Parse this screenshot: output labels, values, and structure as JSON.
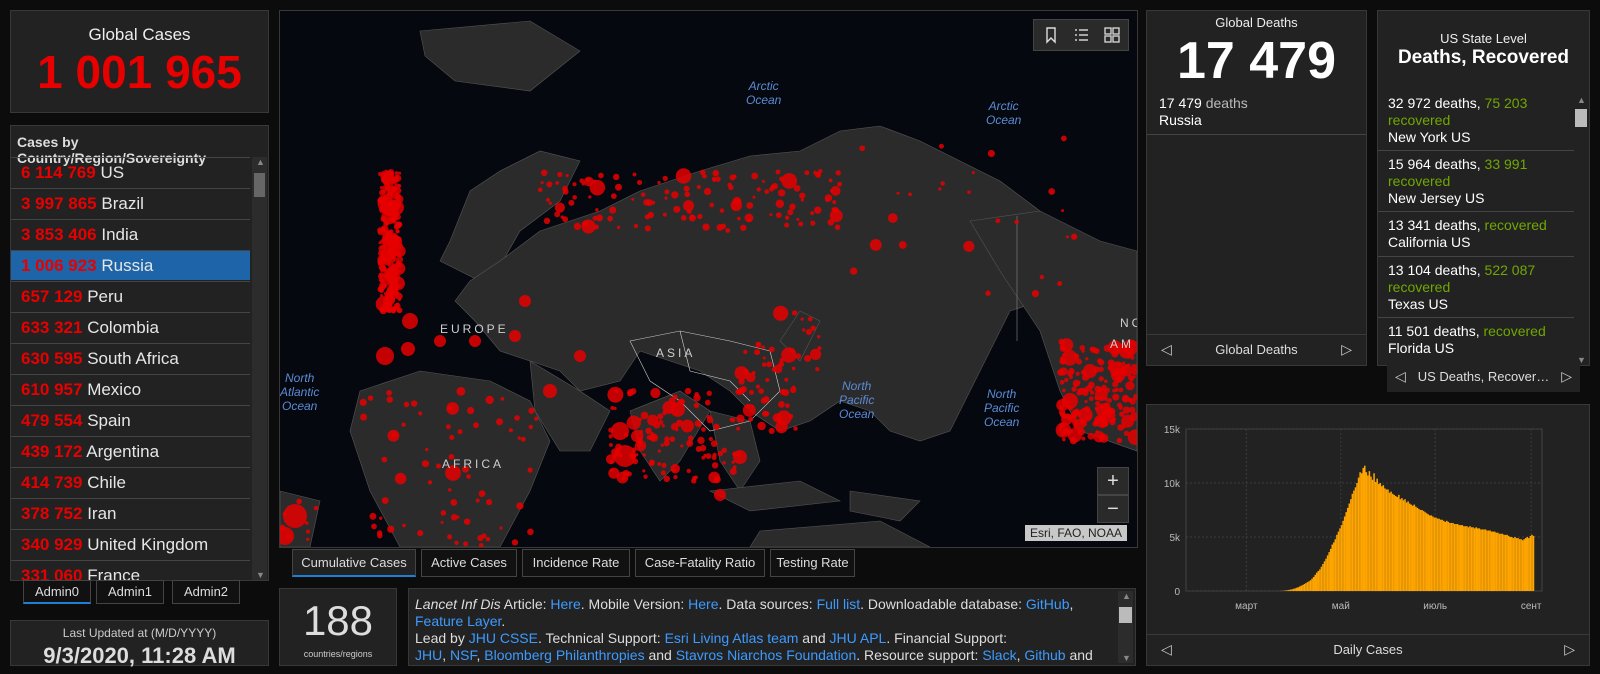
{
  "global_cases": {
    "title": "Global Cases",
    "value": "1 001 965"
  },
  "country_list": {
    "header": "Cases by Country/Region/Sovereignty",
    "rows": [
      {
        "num": "6 114 769",
        "name": "US"
      },
      {
        "num": "3 997 865",
        "name": "Brazil"
      },
      {
        "num": "3 853 406",
        "name": "India"
      },
      {
        "num": "1 006 923",
        "name": "Russia"
      },
      {
        "num": "657 129",
        "name": "Peru"
      },
      {
        "num": "633 321",
        "name": "Colombia"
      },
      {
        "num": "630 595",
        "name": "South Africa"
      },
      {
        "num": "610 957",
        "name": "Mexico"
      },
      {
        "num": "479 554",
        "name": "Spain"
      },
      {
        "num": "439 172",
        "name": "Argentina"
      },
      {
        "num": "414 739",
        "name": "Chile"
      },
      {
        "num": "378 752",
        "name": "Iran"
      },
      {
        "num": "340 929",
        "name": "United Kingdom"
      },
      {
        "num": "331 060",
        "name": "France"
      }
    ]
  },
  "admin_tabs": [
    "Admin0",
    "Admin1",
    "Admin2"
  ],
  "last_updated": {
    "label": "Last Updated at (M/D/YYYY)",
    "value": "9/3/2020, 11:28 AM"
  },
  "map": {
    "oceans": [
      {
        "l1": "Arctic",
        "l2": "Ocean"
      },
      {
        "l1": "Arctic",
        "l2": "Ocean"
      },
      {
        "l1": "North",
        "l2": "Atlantic",
        "l3": "Ocean"
      },
      {
        "l1": "North",
        "l2": "Pacific",
        "l3": "Ocean"
      },
      {
        "l1": "North",
        "l2": "Pacific",
        "l3": "Ocean"
      }
    ],
    "continents": [
      "EUROPE",
      "ASIA",
      "AFRICA",
      "NO",
      "AM"
    ],
    "attribution": "Esri, FAO, NOAA",
    "zoom_in": "+",
    "zoom_out": "−"
  },
  "map_tabs": [
    "Cumulative Cases",
    "Active Cases",
    "Incidence Rate",
    "Case-Fatality Ratio",
    "Testing Rate"
  ],
  "countries_count": {
    "value": "188",
    "label": "countries/regions"
  },
  "info": {
    "s1": "Lancet Inf Dis",
    "s2": " Article: ",
    "a1": "Here",
    "s3": ". Mobile Version: ",
    "a2": "Here",
    "s4": ". Data sources: ",
    "a3": "Full list",
    "s5": ". Downloadable database: ",
    "a4": "GitHub",
    "s6": ",",
    "a5": "Feature Layer",
    "s7": ".",
    "s8": "Lead by ",
    "a6": "JHU CSSE",
    "s9": ". Technical Support: ",
    "a7": "Esri Living Atlas team",
    "s10": " and ",
    "a8": "JHU APL",
    "s11": ". Financial Support:",
    "a9": "JHU",
    "s12": ", ",
    "a10": "NSF",
    "s13": ", ",
    "a11": "Bloomberg Philanthropies",
    "s14": " and ",
    "a12": "Stavros Niarchos Foundation",
    "s15": ". Resource support: ",
    "a13": "Slack",
    "s16": ", ",
    "a14": "Github",
    "s17": " and"
  },
  "global_deaths": {
    "title": "Global Deaths",
    "value": "17 479",
    "item_num": "17 479",
    "item_unit": " deaths",
    "item_place": "Russia",
    "pager_label": "Global Deaths"
  },
  "us_state": {
    "title1": "US State Level",
    "title2": "Deaths, Recovered",
    "rows": [
      {
        "deaths": "32 972 deaths, ",
        "recovered_num": "75 203",
        "recovered": "recovered",
        "place": "New York US"
      },
      {
        "deaths": "15 964 deaths, ",
        "recovered_num": "33 991",
        "recovered": "recovered",
        "place": "New Jersey US"
      },
      {
        "deaths": "13 341 deaths, ",
        "recovered_num": "",
        "recovered": "recovered",
        "place": "California US"
      },
      {
        "deaths": "13 104 deaths, ",
        "recovered_num": "522 087",
        "recovered": "recovered",
        "place": "Texas US"
      },
      {
        "deaths": "11 501 deaths, ",
        "recovered_num": "",
        "recovered": "recovered",
        "place": "Florida US"
      }
    ],
    "pager_label": "US Deaths, Recover…"
  },
  "daily_chart_pager": "Daily Cases",
  "colors": {
    "case_red": "#e60000",
    "recovered_green": "#70a800",
    "bar_orange": "#ffa500",
    "link_blue": "#3d9bff",
    "selected_blue": "#1d64a8"
  },
  "chart_data": {
    "type": "bar",
    "title": "",
    "xlabel": "",
    "ylabel": "",
    "x_ticks": [
      "март",
      "май",
      "июль",
      "сент"
    ],
    "y_ticks": [
      "0",
      "5k",
      "10k",
      "15k"
    ],
    "ylim": [
      0,
      15000
    ],
    "grid": true,
    "pager_label": "Daily Cases",
    "series": [
      {
        "start": "2020-01-22",
        "values": [
          0,
          0,
          0,
          0,
          0,
          0,
          0,
          0,
          0,
          0,
          0,
          0,
          0,
          0,
          0,
          0,
          0,
          0,
          0,
          0,
          0,
          0,
          0,
          0,
          0,
          0,
          0,
          0,
          0,
          0,
          0,
          0,
          0,
          0,
          0,
          0,
          0,
          0,
          0,
          0,
          0,
          0,
          0,
          0,
          0,
          0,
          0,
          0,
          0,
          0,
          0,
          0,
          0,
          0,
          0,
          0,
          0,
          0,
          0,
          0,
          4,
          10,
          20,
          30,
          50,
          70,
          100,
          130,
          160,
          200,
          250,
          300,
          350,
          420,
          500,
          560,
          650,
          730,
          820,
          900,
          1000,
          1150,
          1300,
          1500,
          1700,
          1850,
          2000,
          2250,
          2500,
          2750,
          3000,
          3300,
          3600,
          3900,
          4300,
          4500,
          4800,
          5200,
          5500,
          5800,
          6100,
          6500,
          6900,
          7300,
          7700,
          8100,
          8500,
          9000,
          9300,
          9600,
          10000,
          10500,
          11000,
          10900,
          11400,
          11600,
          11000,
          10700,
          11100,
          10600,
          10300,
          10900,
          10100,
          10400,
          9900,
          10000,
          9700,
          9800,
          9500,
          9400,
          9400,
          9100,
          9200,
          9000,
          8900,
          8800,
          8700,
          8900,
          8500,
          8600,
          8400,
          8500,
          8200,
          8300,
          8100,
          8000,
          7900,
          8000,
          7800,
          7700,
          7600,
          7500,
          7500,
          7400,
          7300,
          7200,
          7100,
          7000,
          7000,
          6900,
          6800,
          6800,
          6700,
          6700,
          6600,
          6600,
          6500,
          6400,
          6500,
          6400,
          6300,
          6300,
          6300,
          6200,
          6200,
          6200,
          6100,
          6100,
          6100,
          6000,
          6000,
          6000,
          5900,
          6000,
          5900,
          5900,
          5800,
          5900,
          5800,
          5800,
          5700,
          5700,
          5700,
          5700,
          5600,
          5600,
          5600,
          5500,
          5500,
          5500,
          5400,
          5400,
          5300,
          5300,
          5300,
          5200,
          5200,
          5200,
          5100,
          5000,
          5000,
          4900,
          5000,
          4900,
          4900,
          4800,
          4800,
          4700,
          4800,
          4900,
          5000,
          4900,
          5100,
          5200,
          5100
        ]
      }
    ]
  }
}
